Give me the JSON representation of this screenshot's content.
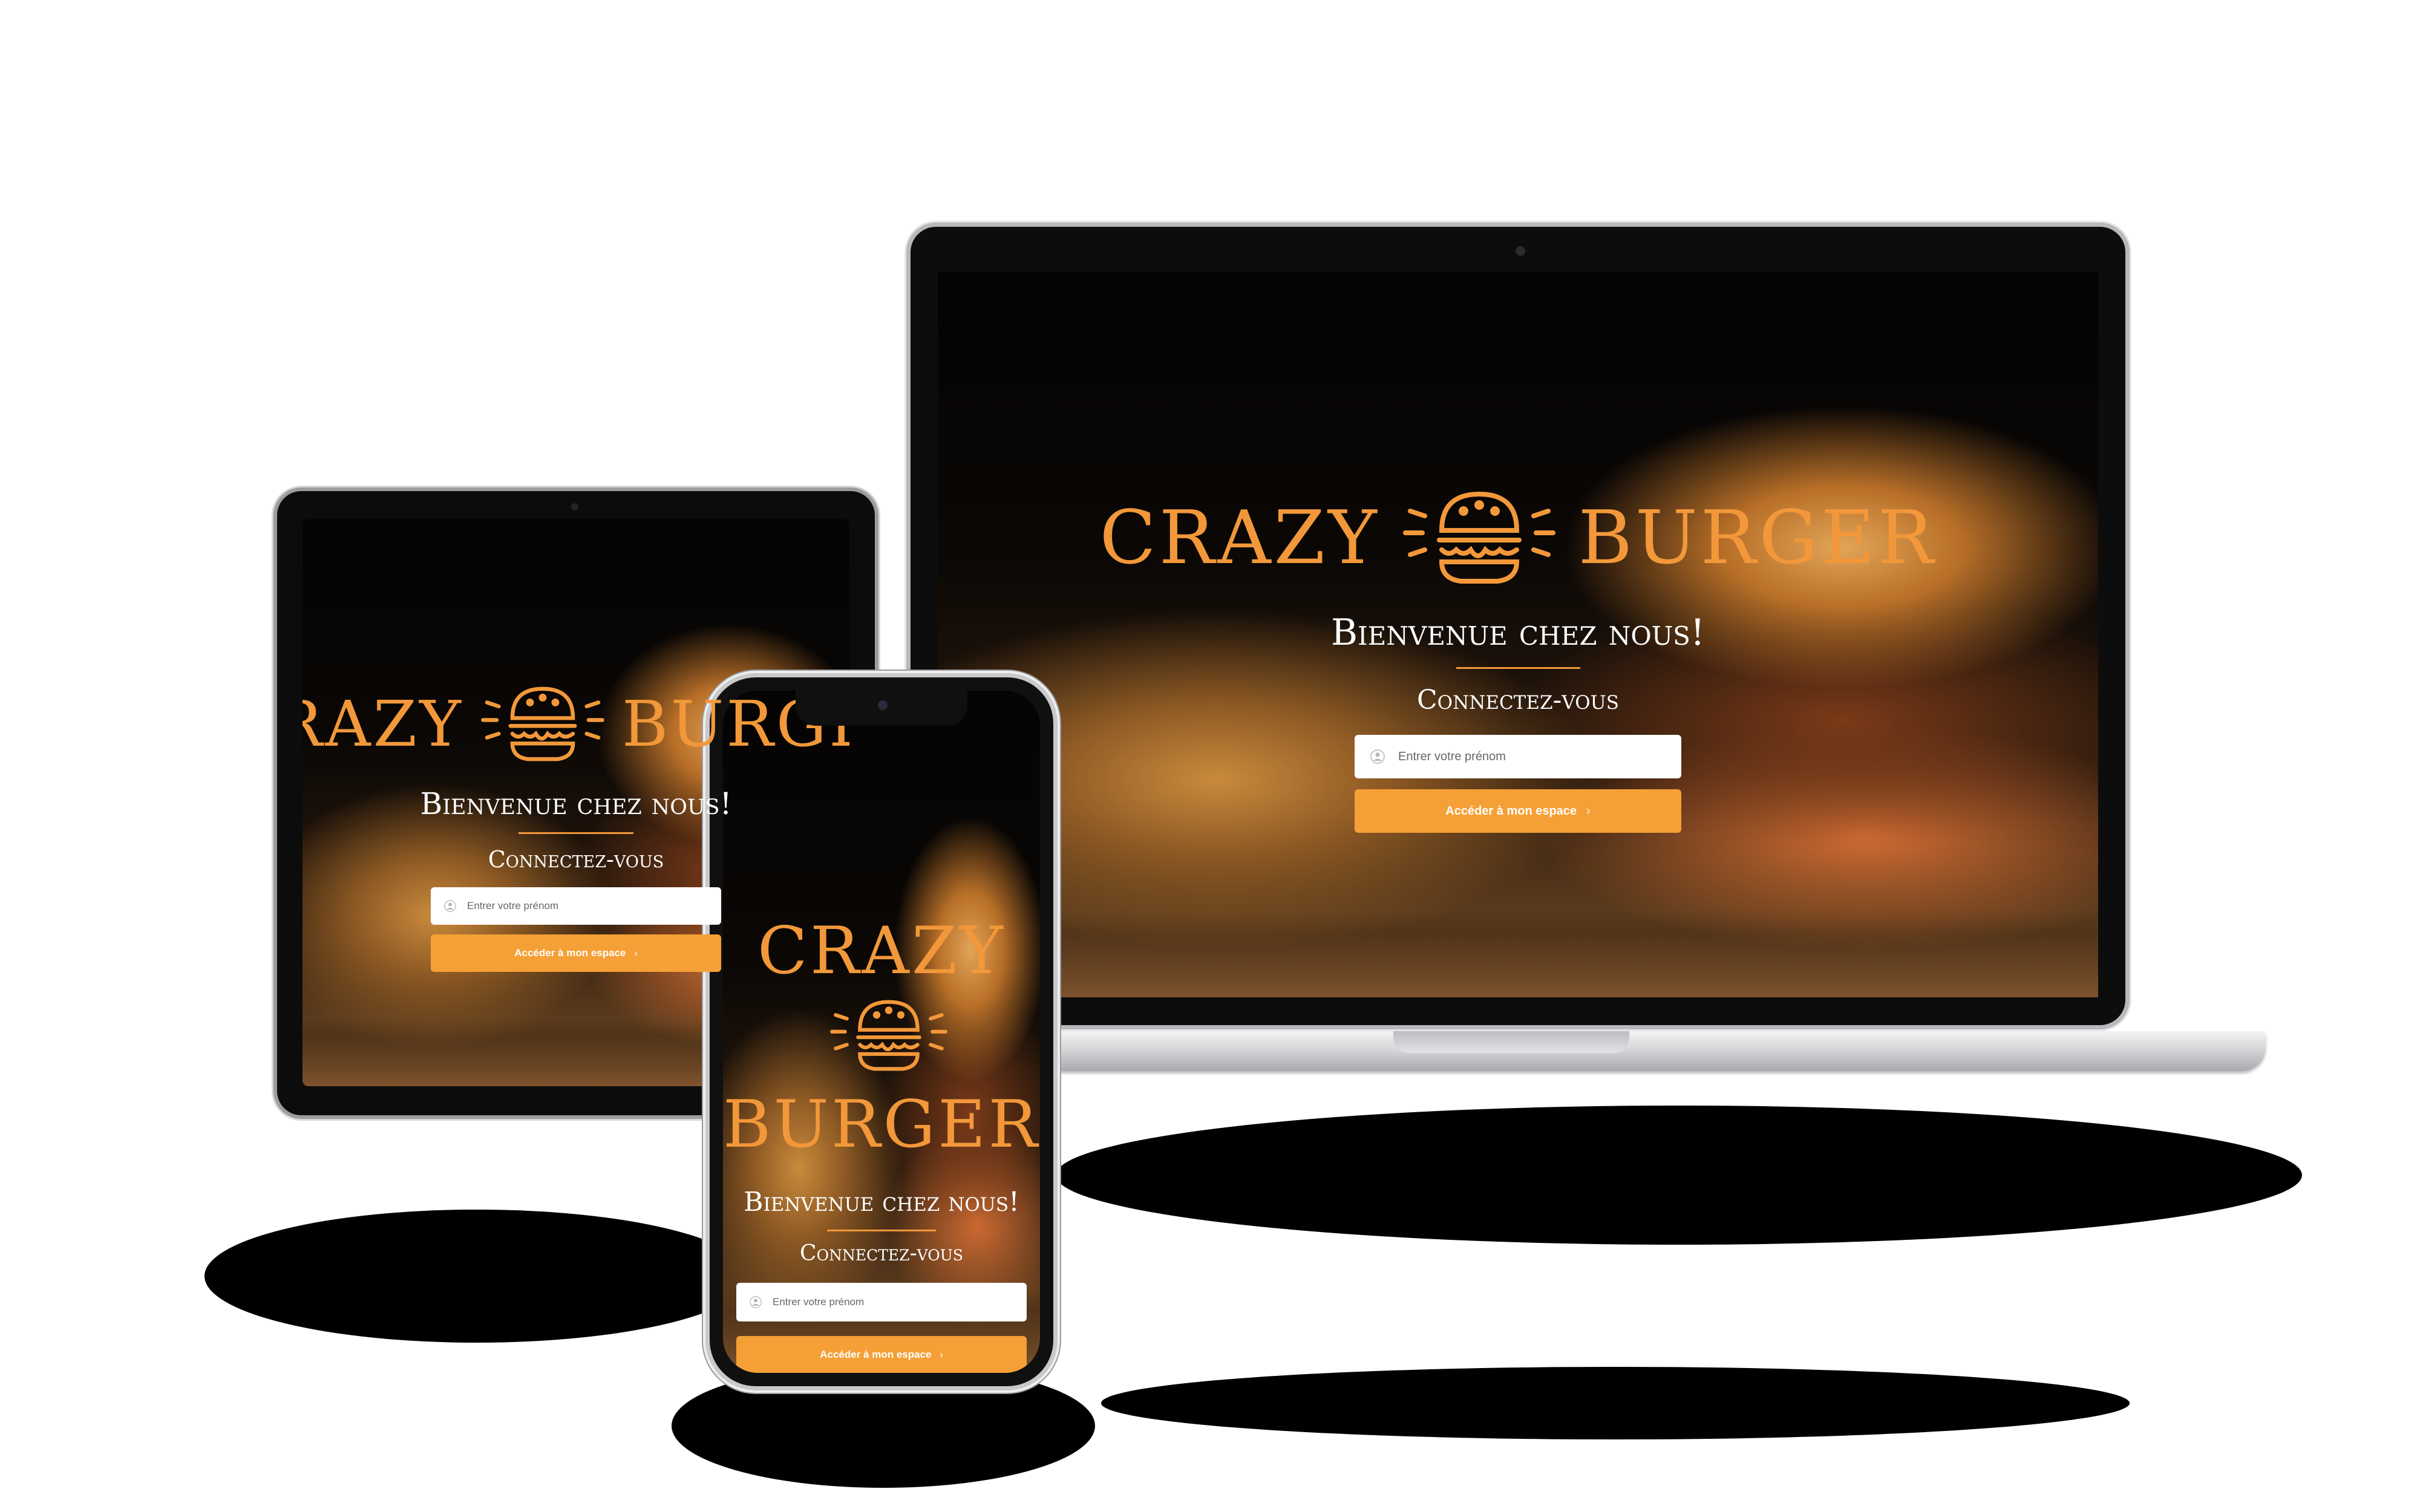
{
  "app": {
    "brand_left": "Crazy",
    "brand_right": "Burger",
    "welcome": "Bienvenue chez nous!",
    "subtitle": "Connectez-vous",
    "input_placeholder": "Entrer votre prénom",
    "cta_label": "Accéder à mon espace",
    "cta_chevron": "›"
  },
  "theme": {
    "accent": "#f2983a",
    "button": "#f5a036",
    "text": "#ffffff",
    "input_bg": "#ffffff"
  },
  "devices": [
    "laptop",
    "tablet",
    "phone"
  ],
  "icons": {
    "logo": "burger-icon",
    "input": "user-icon",
    "button": "chevron-right-icon"
  }
}
